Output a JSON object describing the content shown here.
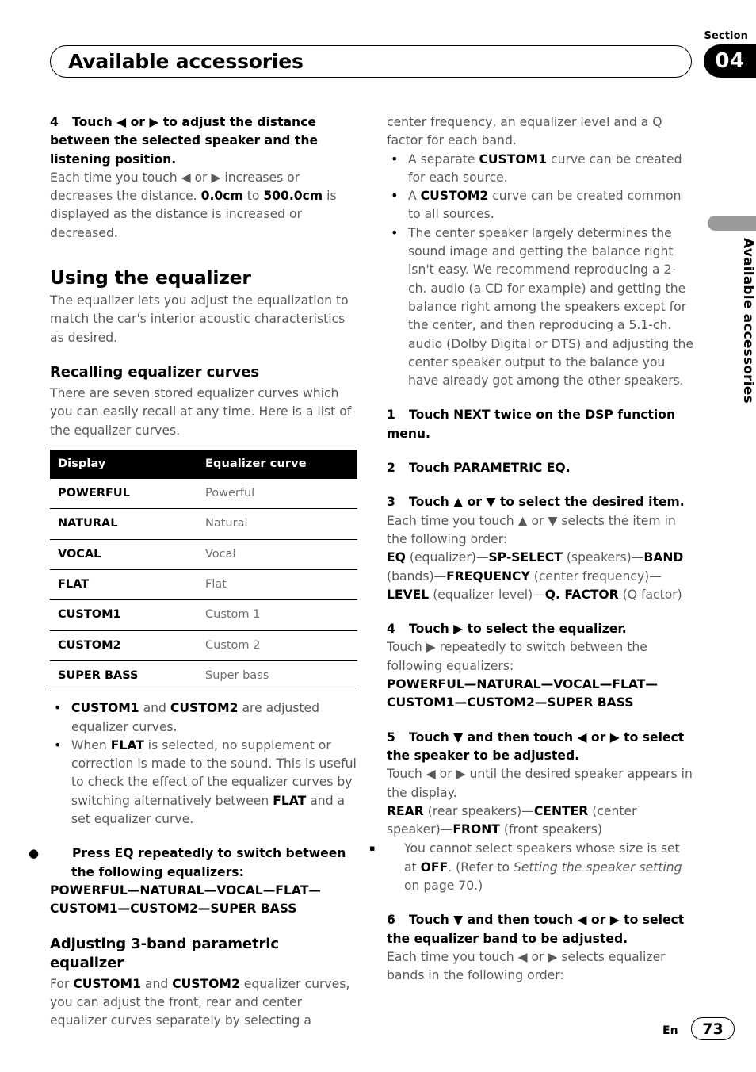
{
  "header": {
    "section_label": "Section",
    "section_number": "04",
    "title": "Available accessories"
  },
  "side_tab": {
    "text": "Available accessories"
  },
  "footer": {
    "language": "En",
    "page_number": "73"
  },
  "left_column": {
    "step4": {
      "num": "4",
      "heading": "Touch ◀ or ▶ to adjust the distance between the selected speaker and the listening position.",
      "body_a": "Each time you touch ◀ or ▶ increases or decreases the distance. ",
      "bold_min": "0.0cm",
      "body_b": " to ",
      "bold_max": "500.0cm",
      "body_c": " is displayed as the distance is increased or decreased."
    },
    "using_equalizer": {
      "heading": "Using the equalizer",
      "body": "The equalizer lets you adjust the equalization to match the car's interior acoustic characteristics as desired."
    },
    "recalling": {
      "heading": "Recalling equalizer curves",
      "body": "There are seven stored equalizer curves which you can easily recall at any time. Here is a list of the equalizer curves."
    },
    "table": {
      "headers": [
        "Display",
        "Equalizer curve"
      ],
      "rows": [
        {
          "display": "POWERFUL",
          "curve": "Powerful"
        },
        {
          "display": "NATURAL",
          "curve": "Natural"
        },
        {
          "display": "VOCAL",
          "curve": "Vocal"
        },
        {
          "display": "FLAT",
          "curve": "Flat"
        },
        {
          "display": "CUSTOM1",
          "curve": "Custom 1"
        },
        {
          "display": "CUSTOM2",
          "curve": "Custom 2"
        },
        {
          "display": "SUPER BASS",
          "curve": "Super bass"
        }
      ]
    },
    "bullets": [
      {
        "pre": "",
        "b1": "CUSTOM1",
        "mid": " and ",
        "b2": "CUSTOM2",
        "post": " are adjusted equalizer curves."
      },
      {
        "pre": "When ",
        "b1": "FLAT",
        "mid": " is selected, no supplement or correction is made to the sound. This is useful to check the effect of the equalizer curves by switching alternatively between ",
        "b2": "FLAT",
        "post": " and a set equalizer curve."
      }
    ],
    "press_eq": {
      "marker": "●",
      "heading": "Press EQ repeatedly to switch between the following equalizers:",
      "chain": "POWERFUL—NATURAL—VOCAL—FLAT—CUSTOM1—CUSTOM2—SUPER BASS"
    },
    "adjusting": {
      "heading": "Adjusting 3-band parametric equalizer",
      "body_a": "For ",
      "b1": "CUSTOM1",
      "body_b": " and ",
      "b2": "CUSTOM2",
      "body_c": " equalizer curves, you can adjust the front, rear and center equalizer curves separately by selecting a"
    }
  },
  "right_column": {
    "continuation": "center frequency, an equalizer level and a Q factor for each band.",
    "bullets": [
      {
        "pre": "A separate ",
        "b1": "CUSTOM1",
        "post": " curve can be created for each source."
      },
      {
        "pre": "A ",
        "b1": "CUSTOM2",
        "post": " curve can be created common to all sources."
      },
      {
        "pre": "The center speaker largely determines the sound image and getting the balance right isn't easy. We recommend reproducing a 2-ch. audio (a CD for example) and getting the balance right among the speakers except for the center, and then reproducing a 5.1-ch. audio (Dolby Digital or DTS) and adjusting the center speaker output to the balance you have already got among the other speakers.",
        "b1": "",
        "post": ""
      }
    ],
    "step1": {
      "num": "1",
      "heading": "Touch NEXT twice on the DSP function menu."
    },
    "step2": {
      "num": "2",
      "heading": "Touch PARAMETRIC EQ."
    },
    "step3": {
      "num": "3",
      "heading": "Touch ▲ or ▼ to select the desired item.",
      "body": "Each time you touch ▲ or ▼ selects the item in the following order:",
      "order": [
        {
          "bold": "EQ",
          "plain": " (equalizer)—"
        },
        {
          "bold": "SP-SELECT",
          "plain": " (speakers)—"
        },
        {
          "bold": "BAND",
          "plain": " (bands)—"
        },
        {
          "bold": "FREQUENCY",
          "plain": " (center frequency)—"
        },
        {
          "bold": "LEVEL",
          "plain": " (equalizer level)—"
        },
        {
          "bold": "Q. FACTOR",
          "plain": " (Q factor)"
        }
      ]
    },
    "step4": {
      "num": "4",
      "heading": "Touch ▶ to select the equalizer.",
      "body": "Touch ▶ repeatedly to switch between the following equalizers:",
      "chain": "POWERFUL—NATURAL—VOCAL—FLAT—CUSTOM1—CUSTOM2—SUPER BASS"
    },
    "step5": {
      "num": "5",
      "heading": "Touch ▼ and then touch ◀ or ▶ to select the speaker to be adjusted.",
      "body": "Touch ◀ or ▶ until the desired speaker appears in the display.",
      "order": [
        {
          "bold": "REAR",
          "plain": " (rear speakers)—"
        },
        {
          "bold": "CENTER",
          "plain": " (center speaker)—"
        },
        {
          "bold": "FRONT",
          "plain": " (front speakers)"
        }
      ],
      "note_marker": "▪",
      "note_a": "You cannot select speakers whose size is set at ",
      "note_bold": "OFF",
      "note_b": ". (Refer to ",
      "note_italic": "Setting the speaker setting",
      "note_c": " on page 70.)"
    },
    "step6": {
      "num": "6",
      "heading": "Touch ▼ and then touch ◀ or ▶ to select the equalizer band to be adjusted.",
      "body": "Each time you touch ◀ or ▶ selects equalizer bands in the following order:"
    }
  }
}
